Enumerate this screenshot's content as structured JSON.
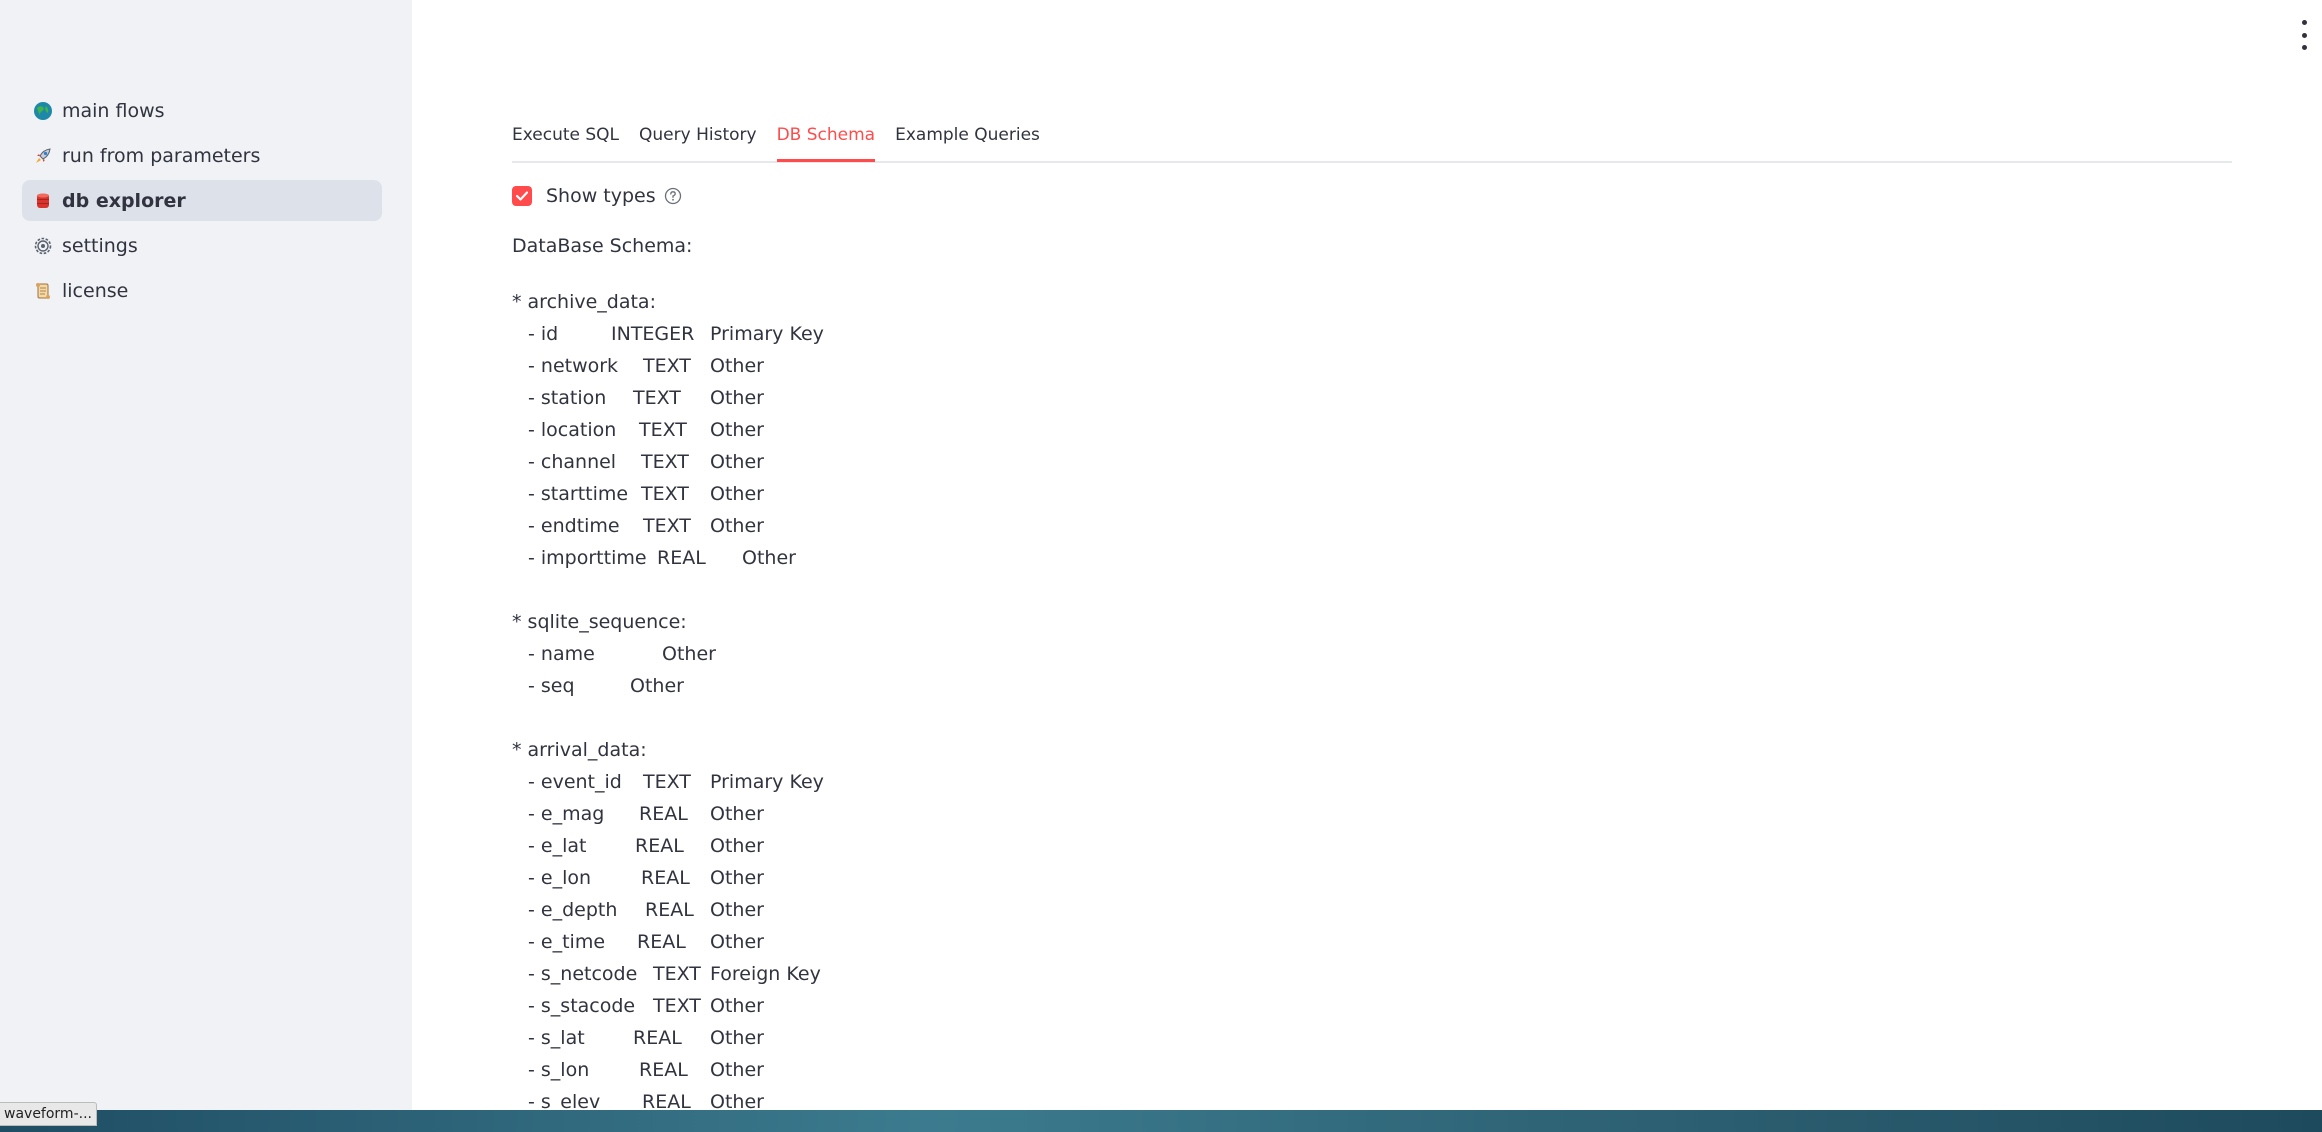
{
  "sidebar": {
    "items": [
      {
        "label": "main flows",
        "icon": "globe-icon",
        "active": false
      },
      {
        "label": "run from parameters",
        "icon": "rocket-icon",
        "active": false
      },
      {
        "label": "db explorer",
        "icon": "database-icon",
        "active": true
      },
      {
        "label": "settings",
        "icon": "gear-icon",
        "active": false
      },
      {
        "label": "license",
        "icon": "scroll-icon",
        "active": false
      }
    ]
  },
  "tabs": [
    {
      "label": "Execute SQL",
      "active": false
    },
    {
      "label": "Query History",
      "active": false
    },
    {
      "label": "DB Schema",
      "active": true
    },
    {
      "label": "Example Queries",
      "active": false
    }
  ],
  "show_types": {
    "label": "Show types",
    "checked": true
  },
  "schema": {
    "title": "DataBase Schema:",
    "tables": [
      {
        "name": "* archive_data:",
        "columns": [
          {
            "name": "- id",
            "type": "INTEGER",
            "kind": "Primary Key"
          },
          {
            "name": "- network",
            "type": "TEXT",
            "kind": "Other"
          },
          {
            "name": "- station",
            "type": "TEXT",
            "kind": "Other"
          },
          {
            "name": "- location",
            "type": "TEXT",
            "kind": "Other"
          },
          {
            "name": "- channel",
            "type": "TEXT",
            "kind": "Other"
          },
          {
            "name": "- starttime",
            "type": "TEXT",
            "kind": "Other"
          },
          {
            "name": "- endtime",
            "type": "TEXT",
            "kind": "Other"
          },
          {
            "name": "- importtime",
            "type": "REAL",
            "kind": "Other"
          }
        ]
      },
      {
        "name": "* sqlite_sequence:",
        "columns": [
          {
            "name": "- name",
            "type": "",
            "kind": "Other"
          },
          {
            "name": "- seq",
            "type": "",
            "kind": "Other"
          }
        ]
      },
      {
        "name": "* arrival_data:",
        "columns": [
          {
            "name": "- event_id",
            "type": "TEXT",
            "kind": "Primary Key"
          },
          {
            "name": "- e_mag",
            "type": "REAL",
            "kind": "Other"
          },
          {
            "name": "- e_lat",
            "type": "REAL",
            "kind": "Other"
          },
          {
            "name": "- e_lon",
            "type": "REAL",
            "kind": "Other"
          },
          {
            "name": "- e_depth",
            "type": "REAL",
            "kind": "Other"
          },
          {
            "name": "- e_time",
            "type": "REAL",
            "kind": "Other"
          },
          {
            "name": "- s_netcode",
            "type": "TEXT",
            "kind": "Foreign Key"
          },
          {
            "name": "- s_stacode",
            "type": "TEXT",
            "kind": "Other"
          },
          {
            "name": "- s_lat",
            "type": "REAL",
            "kind": "Other"
          },
          {
            "name": "- s_lon",
            "type": "REAL",
            "kind": "Other"
          },
          {
            "name": "- s_elev",
            "type": "REAL",
            "kind": "Other"
          }
        ]
      }
    ]
  },
  "status_bar": {
    "text": "waveform-..."
  },
  "colors": {
    "accent": "#ff4b4b",
    "sidebar_bg": "#f0f2f6",
    "active_item_bg": "#dde1ea"
  }
}
